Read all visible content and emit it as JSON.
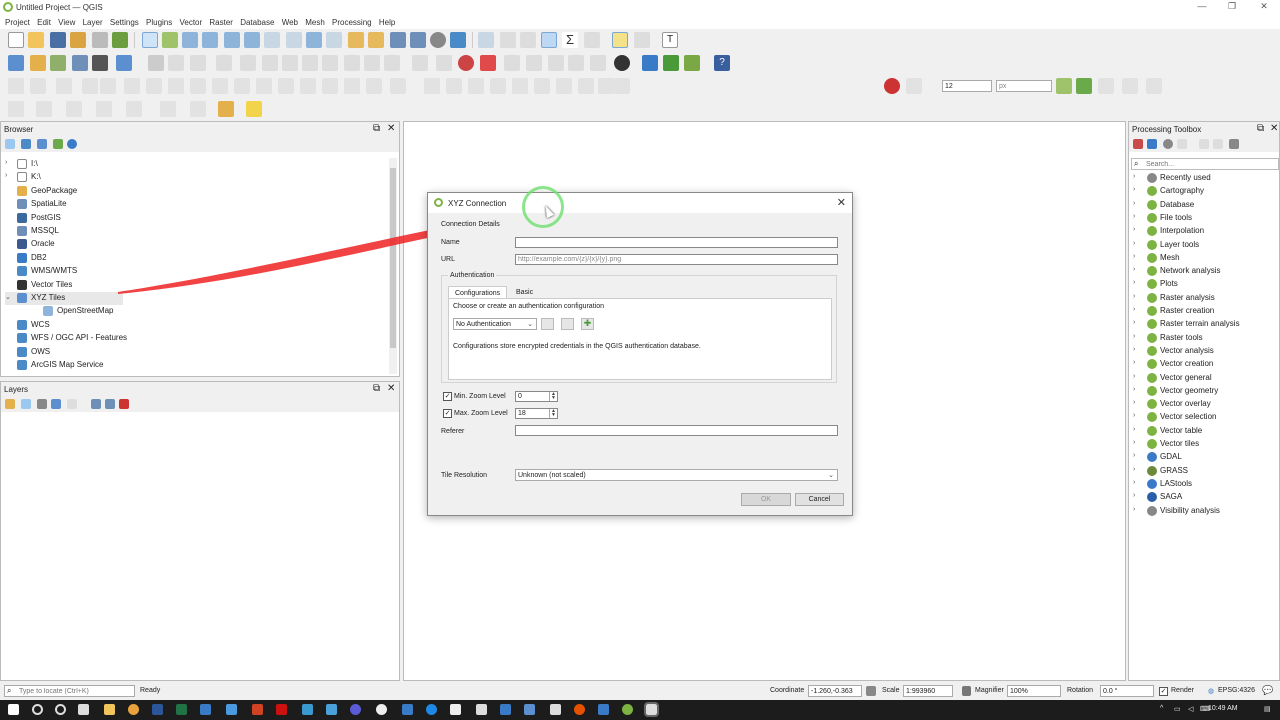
{
  "window": {
    "title": "Untitled Project — QGIS",
    "controls": [
      "—",
      "❐",
      "✕"
    ]
  },
  "menubar": [
    "Project",
    "Edit",
    "View",
    "Layer",
    "Settings",
    "Plugins",
    "Vector",
    "Raster",
    "Database",
    "Web",
    "Mesh",
    "Processing",
    "Help"
  ],
  "browser": {
    "title": "Browser",
    "items": [
      {
        "label": "I:\\",
        "icon": "folder-icon",
        "arrow": "›"
      },
      {
        "label": "K:\\",
        "icon": "folder-icon",
        "arrow": "›"
      },
      {
        "label": "GeoPackage",
        "icon": "geopackage-icon",
        "arrow": ""
      },
      {
        "label": "SpatiaLite",
        "icon": "spatialite-icon",
        "arrow": ""
      },
      {
        "label": "PostGIS",
        "icon": "postgis-icon",
        "arrow": ""
      },
      {
        "label": "MSSQL",
        "icon": "mssql-icon",
        "arrow": ""
      },
      {
        "label": "Oracle",
        "icon": "oracle-icon",
        "arrow": ""
      },
      {
        "label": "DB2",
        "icon": "db2-icon",
        "arrow": ""
      },
      {
        "label": "WMS/WMTS",
        "icon": "wms-icon",
        "arrow": ""
      },
      {
        "label": "Vector Tiles",
        "icon": "vector-tiles-icon",
        "arrow": ""
      },
      {
        "label": "XYZ Tiles",
        "icon": "xyz-tiles-icon",
        "arrow": "⌄"
      },
      {
        "label": "OpenStreetMap",
        "icon": "xyz-layer-icon",
        "arrow": ""
      },
      {
        "label": "WCS",
        "icon": "wcs-icon",
        "arrow": ""
      },
      {
        "label": "WFS / OGC API - Features",
        "icon": "wfs-icon",
        "arrow": ""
      },
      {
        "label": "OWS",
        "icon": "ows-icon",
        "arrow": ""
      },
      {
        "label": "ArcGIS Map Service",
        "icon": "arcgis-icon",
        "arrow": ""
      }
    ]
  },
  "layers": {
    "title": "Layers"
  },
  "toolbox": {
    "title": "Processing Toolbox",
    "search_placeholder": "Search...",
    "items": [
      "Recently used",
      "Cartography",
      "Database",
      "File tools",
      "Interpolation",
      "Layer tools",
      "Mesh",
      "Network analysis",
      "Plots",
      "Raster analysis",
      "Raster creation",
      "Raster terrain analysis",
      "Raster tools",
      "Vector analysis",
      "Vector creation",
      "Vector general",
      "Vector geometry",
      "Vector overlay",
      "Vector selection",
      "Vector table",
      "Vector tiles",
      "GDAL",
      "GRASS",
      "LAStools",
      "SAGA",
      "Visibility analysis"
    ]
  },
  "dialog": {
    "title": "XYZ Connection",
    "section": "Connection Details",
    "name_label": "Name",
    "name_value": "",
    "url_label": "URL",
    "url_placeholder": "http://example.com/{z}/{x}/{y}.png",
    "auth_label": "Authentication",
    "tabs": [
      "Configurations",
      "Basic"
    ],
    "auth_prompt": "Choose or create an authentication configuration",
    "auth_combo": "No Authentication",
    "auth_note": "Configurations store encrypted credentials in the QGIS authentication database.",
    "min_zoom_label": "Min. Zoom Level",
    "min_zoom": "0",
    "max_zoom_label": "Max. Zoom Level",
    "max_zoom": "18",
    "referer_label": "Referer",
    "tile_res_label": "Tile Resolution",
    "tile_res_value": "Unknown (not scaled)",
    "ok": "OK",
    "cancel": "Cancel"
  },
  "status": {
    "locate_placeholder": "Type to locate (Ctrl+K)",
    "ready": "Ready",
    "coordinate_label": "Coordinate",
    "coordinate": "-1.260,-0.363",
    "scale_label": "Scale",
    "scale": "1:993960",
    "magnifier_label": "Magnifier",
    "magnifier": "100%",
    "rotation_label": "Rotation",
    "rotation": "0.0 °",
    "render_label": "Render",
    "crs": "EPSG:4326"
  },
  "snapping": {
    "tolerance": "12",
    "units": "px"
  },
  "taskbar": {
    "time": "10:49 AM"
  }
}
